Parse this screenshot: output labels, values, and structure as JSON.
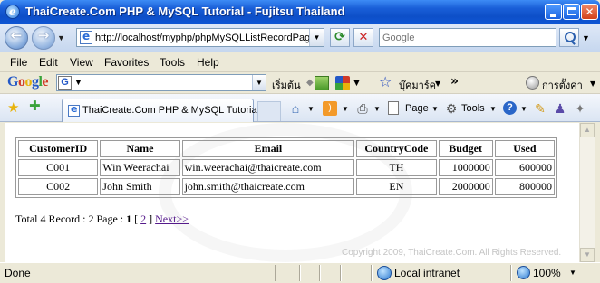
{
  "window": {
    "title": "ThaiCreate.Com PHP & MySQL Tutorial - Fujitsu Thailand"
  },
  "address_bar": {
    "url": "http://localhost/myphp/phpMySQLListRecordPagi"
  },
  "search": {
    "placeholder": "Google"
  },
  "menu": {
    "items": [
      "File",
      "Edit",
      "View",
      "Favorites",
      "Tools",
      "Help"
    ]
  },
  "google_toolbar": {
    "logo": "Google",
    "search_label": "เริ่มต้น",
    "bookmarks_label": "บุ๊คมาร์ค",
    "more": "»",
    "settings_label": "การตั้งค่า"
  },
  "tab": {
    "label": "ThaiCreate.Com PHP & MySQL Tutorial"
  },
  "command_bar": {
    "page_label": "Page",
    "tools_label": "Tools"
  },
  "table": {
    "headers": [
      "CustomerID",
      "Name",
      "Email",
      "CountryCode",
      "Budget",
      "Used"
    ],
    "rows": [
      [
        "C001",
        "Win Weerachai",
        "win.weerachai@thaicreate.com",
        "TH",
        "1000000",
        "600000"
      ],
      [
        "C002",
        "John Smith",
        "john.smith@thaicreate.com",
        "EN",
        "2000000",
        "800000"
      ]
    ]
  },
  "pager": {
    "summary": "Total 4 Record : 2 Page :",
    "current_page": "1",
    "open_bracket": "[",
    "page_2": "2",
    "close_bracket": "]",
    "next": "Next>>"
  },
  "footer": {
    "copyright": "Copyright 2009, ThaiCreate.Com. All Rights Reserved."
  },
  "status": {
    "text": "Done",
    "zone": "Local intranet",
    "zoom": "100%"
  }
}
